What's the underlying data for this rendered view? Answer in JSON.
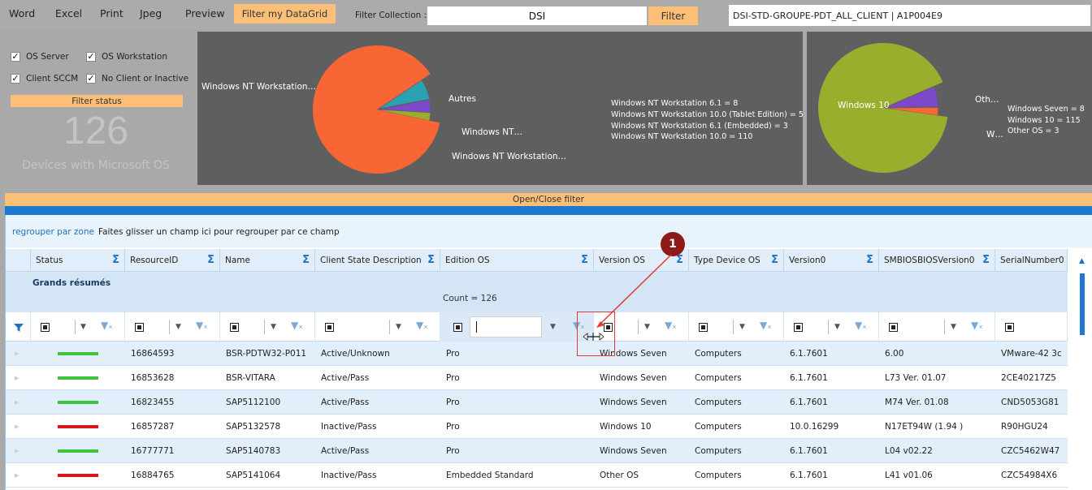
{
  "toolbar": {
    "word": "Word",
    "excel": "Excel",
    "print": "Print",
    "jpeg": "Jpeg",
    "preview": "Preview",
    "filter_grid": "Filter my DataGrid",
    "collection_label": "Filter Collection :",
    "collection_value": "DSI",
    "filter_button": "Filter",
    "collection_id": "DSI-STD-GROUPE-PDT_ALL_CLIENT  |  A1P004E9"
  },
  "filters": {
    "os_server": "OS Server",
    "os_workstation": "OS Workstation",
    "client_sccm": "Client SCCM",
    "no_client": "No Client or Inactive",
    "filter_status": "Filter status",
    "count": "126",
    "count_label": "Devices with Microsoft OS"
  },
  "chart_data": [
    {
      "type": "pie",
      "labels": [
        "Windows NT Workstation…",
        "Autres",
        "Windows NT…",
        "Windows NT Workstation…"
      ],
      "legend": [
        "Windows NT Workstation 6.1 = 8",
        "Windows NT Workstation 10.0 (Tablet Edition) = 5",
        "Windows NT Workstation 6.1 (Embedded) = 3",
        "Windows NT Workstation 10.0 = 110"
      ],
      "categories": [
        "Windows NT Workstation 10.0",
        "Windows NT Workstation 6.1",
        "Windows NT Workstation 10.0 (Tablet Edition)",
        "Windows NT Workstation 6.1 (Embedded)"
      ],
      "values": [
        110,
        8,
        5,
        3
      ],
      "colors": [
        "#f96636",
        "#2ba2b1",
        "#7c4ac9",
        "#9aae2e"
      ]
    },
    {
      "type": "pie",
      "labels": [
        "Windows 10",
        "Oth…",
        "W…"
      ],
      "legend": [
        "Windows Seven = 8",
        "Windows 10 = 115",
        "Other OS = 3"
      ],
      "categories": [
        "Windows 10",
        "Windows Seven",
        "Other OS"
      ],
      "values": [
        115,
        8,
        3
      ],
      "colors": [
        "#9aae2e",
        "#7c4ac9",
        "#f96636"
      ]
    }
  ],
  "open_close": "Open/Close filter",
  "grid": {
    "group_link": "regrouper par zone",
    "group_hint": "Faites glisser un champ ici pour regrouper par ce champ",
    "columns": [
      "Status",
      "ResourceID",
      "Name",
      "Client State Description",
      "Edition OS",
      "Version OS",
      "Type Device OS",
      "Version0",
      "SMBIOSBIOSVersion0",
      "SerialNumber0"
    ],
    "summary_title": "Grands résumés",
    "summary_count": "Count = 126",
    "rows": [
      {
        "status": "green",
        "id": "16864593",
        "name": "BSR-PDTW32-P011",
        "state": "Active/Unknown",
        "edition": "Pro",
        "version_os": "Windows Seven",
        "type": "Computers",
        "version0": "6.1.7601",
        "bios": "6.00",
        "serial": "VMware-42 3c"
      },
      {
        "status": "green",
        "id": "16853628",
        "name": "BSR-VITARA",
        "state": "Active/Pass",
        "edition": "Pro",
        "version_os": "Windows Seven",
        "type": "Computers",
        "version0": "6.1.7601",
        "bios": "L73 Ver. 01.07",
        "serial": "2CE40217Z5"
      },
      {
        "status": "green",
        "id": "16823455",
        "name": "SAP5112100",
        "state": "Active/Pass",
        "edition": "Pro",
        "version_os": "Windows Seven",
        "type": "Computers",
        "version0": "6.1.7601",
        "bios": "M74 Ver. 01.08",
        "serial": "CND5053G81"
      },
      {
        "status": "red",
        "id": "16857287",
        "name": "SAP5132578",
        "state": "Inactive/Pass",
        "edition": "Pro",
        "version_os": "Windows 10",
        "type": "Computers",
        "version0": "10.0.16299",
        "bios": "N17ET94W (1.94 )",
        "serial": "R90HGU24"
      },
      {
        "status": "green",
        "id": "16777771",
        "name": "SAP5140783",
        "state": "Active/Pass",
        "edition": "Pro",
        "version_os": "Windows Seven",
        "type": "Computers",
        "version0": "6.1.7601",
        "bios": "L04 v02.22",
        "serial": "CZC5462W47"
      },
      {
        "status": "red",
        "id": "16884765",
        "name": "SAP5141064",
        "state": "Inactive/Pass",
        "edition": "Embedded Standard",
        "version_os": "Other OS",
        "type": "Computers",
        "version0": "6.1.7601",
        "bios": "L41 v01.06",
        "serial": "CZC54984X6"
      }
    ]
  },
  "colors": {
    "accent_orange": "#fbbf78",
    "accent_blue": "#1d78cf",
    "status_green": "#3dc43d",
    "status_red": "#d61818"
  },
  "annotation": {
    "number": "1"
  }
}
